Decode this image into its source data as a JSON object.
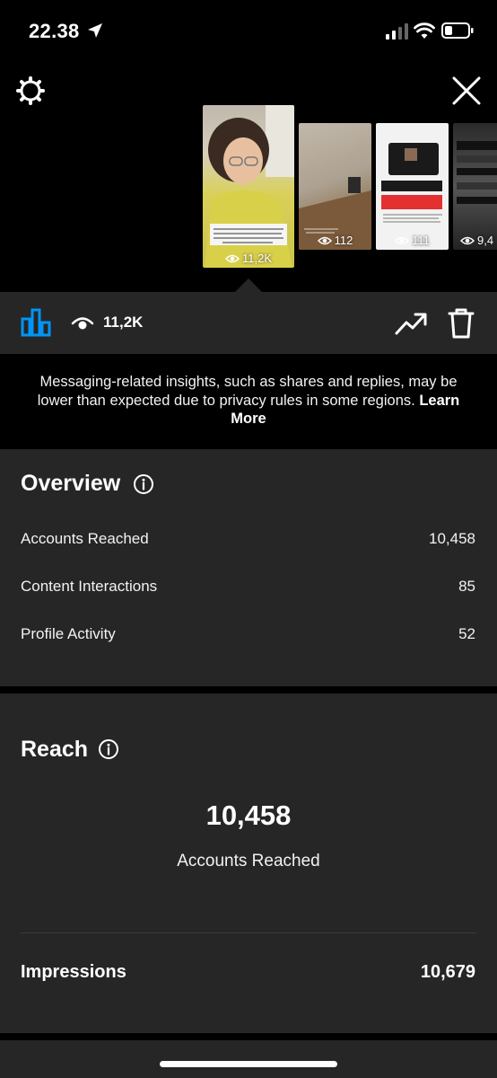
{
  "status": {
    "time": "22.38"
  },
  "stories": [
    {
      "views": "11,2K",
      "caption": "Karena kantor story blog luar waktu kurang tenanghal dan practical sekarang kita kalau ga membuka kabel ke pesawat kalau tanpa gesring"
    },
    {
      "views": "112",
      "caption": "Pagi aku bawa buku ke kantor"
    },
    {
      "views": "111",
      "caption": ""
    },
    {
      "views": "9,4"
    }
  ],
  "statbar": {
    "views": "11,2K"
  },
  "notice": {
    "text": "Messaging-related insights, such as shares and replies, may be lower than expected due to privacy rules in some regions.",
    "link": "Learn More"
  },
  "overview": {
    "title": "Overview",
    "rows": [
      {
        "label": "Accounts Reached",
        "value": "10,458"
      },
      {
        "label": "Content Interactions",
        "value": "85"
      },
      {
        "label": "Profile Activity",
        "value": "52"
      }
    ]
  },
  "reach": {
    "title": "Reach",
    "number": "10,458",
    "caption": "Accounts Reached",
    "impressions_label": "Impressions",
    "impressions_value": "10,679"
  },
  "colors": {
    "accent": "#0095f6",
    "card": "#262626",
    "background": "#000000"
  }
}
